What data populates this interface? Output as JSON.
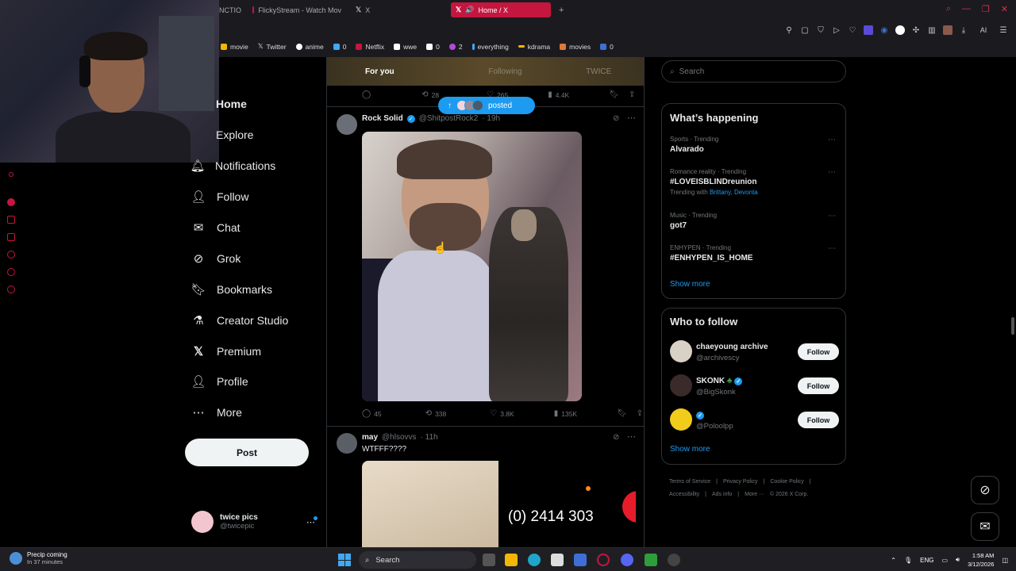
{
  "browser": {
    "tabs": [
      {
        "label": "NCTIO",
        "icon_color": "#333"
      },
      {
        "label": "FlickyStream - Watch Mov",
        "icon_color": "#c4163f"
      },
      {
        "label": "X",
        "icon": "x-logo"
      },
      {
        "label": "Home / X",
        "active": true,
        "icon": "x-logo"
      }
    ],
    "new_tab_label": "+",
    "bookmarks": [
      {
        "label": "movie",
        "color": "#f2b705"
      },
      {
        "label": "Twitter",
        "icon": "x-logo"
      },
      {
        "label": "anime",
        "color": "#ffffff"
      },
      {
        "label": "0",
        "color": "#3fa9f5"
      },
      {
        "label": "Netflix",
        "color": "#c4163f"
      },
      {
        "label": "wwe",
        "color": "#ffffff"
      },
      {
        "label": "0",
        "color": "#ffffff"
      },
      {
        "label": "2",
        "color": "#b44bd6"
      },
      {
        "label": "everything",
        "color": "#3fa9f5"
      },
      {
        "label": "kdrama",
        "color": "#f2b705"
      },
      {
        "label": "movies",
        "color": "#e07a3a"
      },
      {
        "label": "0",
        "color": "#3f6fd6"
      }
    ],
    "toolbar_ai_label": "AI"
  },
  "nav": {
    "items": [
      {
        "label": "Home",
        "icon": "home-icon"
      },
      {
        "label": "Explore",
        "icon": "search-icon"
      },
      {
        "label": "Notifications",
        "icon": "bell-icon"
      },
      {
        "label": "Follow",
        "icon": "follow-icon"
      },
      {
        "label": "Chat",
        "icon": "mail-icon"
      },
      {
        "label": "Grok",
        "icon": "grok-icon"
      },
      {
        "label": "Bookmarks",
        "icon": "bookmark-icon"
      },
      {
        "label": "Creator Studio",
        "icon": "flask-icon"
      },
      {
        "label": "Premium",
        "icon": "x-icon"
      },
      {
        "label": "Profile",
        "icon": "person-icon"
      },
      {
        "label": "More",
        "icon": "more-icon"
      }
    ],
    "post_label": "Post",
    "account": {
      "name": "twice pics",
      "handle": "@twicepic"
    }
  },
  "feed": {
    "tabs": [
      "For you",
      "Following",
      "TWICE"
    ],
    "prev_actions": {
      "reposts": "28",
      "likes": "265",
      "views": "4.4K"
    },
    "posted_pill": "posted",
    "tweet1": {
      "name": "Rock Solid",
      "handle": "@ShitpostRock2",
      "time": "· 19h",
      "replies": "45",
      "reposts": "338",
      "likes": "3.8K",
      "views": "135K"
    },
    "tweet2": {
      "name": "may",
      "handle": "@hlsovvs",
      "time": "· 11h",
      "text": "WTFFF????",
      "image_text": "(0) 2414 303"
    }
  },
  "right": {
    "search_placeholder": "Search",
    "whats_happening": "What’s happening",
    "trends": [
      {
        "meta": "Sports · Trending",
        "name": "Alvarado"
      },
      {
        "meta": "Romance reality · Trending",
        "name": "#LOVEISBLINDreunion",
        "with_prefix": "Trending with",
        "with_links": "Brittany, Devonta"
      },
      {
        "meta": "Music · Trending",
        "name": "got7"
      },
      {
        "meta": "ENHYPEN · Trending",
        "name": "#ENHYPEN_IS_HOME"
      }
    ],
    "show_more": "Show more",
    "who_to_follow": "Who to follow",
    "follow_suggestions": [
      {
        "name": "chaeyoung archive",
        "handle": "@archivescy",
        "button": "Follow"
      },
      {
        "name": "SKONK",
        "handle": "@BigSkonk",
        "button": "Follow"
      },
      {
        "name": "",
        "handle": "@Poloolpp",
        "button": "Follow"
      }
    ],
    "footer": [
      "Terms of Service",
      "|",
      "Privacy Policy",
      "|",
      "Cookie Policy",
      "|",
      "Accessibility",
      "|",
      "Ads info",
      "|",
      "More ···",
      "© 2026 X Corp."
    ]
  },
  "taskbar": {
    "weather_title": "Precip coming",
    "weather_sub": "In 37 minutes",
    "search_label": "Search",
    "lang": "ENG",
    "time": "1:58 AM",
    "date": "3/12/2026"
  },
  "colors": {
    "accent": "#1d9bf0",
    "browser_accent": "#c4163f"
  }
}
